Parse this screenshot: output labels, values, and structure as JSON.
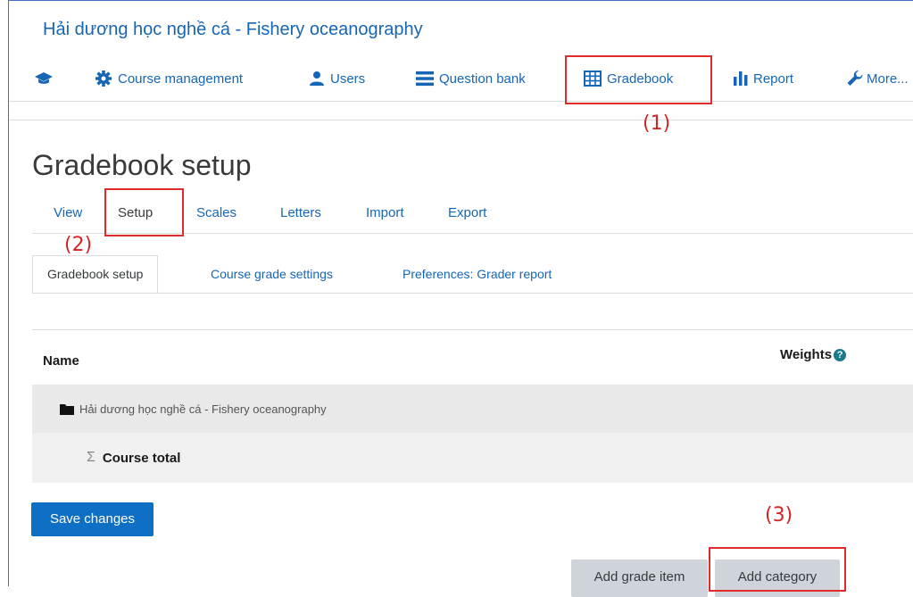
{
  "course": {
    "title": "Hải dương học nghề cá - Fishery oceanography"
  },
  "nav": {
    "course_management": "Course management",
    "users": "Users",
    "question_bank": "Question bank",
    "gradebook": "Gradebook",
    "report": "Report",
    "more": "More..."
  },
  "page": {
    "title": "Gradebook setup"
  },
  "tabs": {
    "view": "View",
    "setup": "Setup",
    "scales": "Scales",
    "letters": "Letters",
    "import": "Import",
    "export": "Export"
  },
  "subtabs": {
    "gradebook_setup": "Gradebook setup",
    "course_grade_settings": "Course grade settings",
    "preferences": "Preferences: Grader report"
  },
  "table": {
    "col_name": "Name",
    "col_weights": "Weights",
    "category_name": "Hải dương học nghề cá - Fishery oceanography",
    "course_total": "Course total"
  },
  "buttons": {
    "save": "Save changes",
    "add_grade_item": "Add grade item",
    "add_category": "Add category"
  },
  "annotations": {
    "one": "(1)",
    "two": "(2)",
    "three": "(3)"
  },
  "colors": {
    "link": "#1666b5",
    "primary_button": "#0f6fc5",
    "annotation_red": "#e02b2b"
  }
}
